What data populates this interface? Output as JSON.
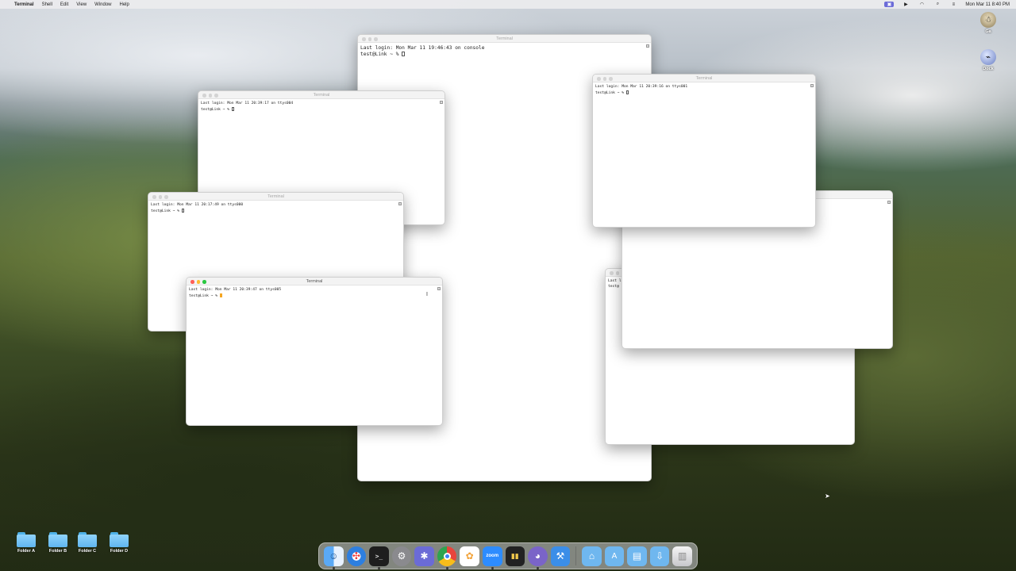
{
  "menubar": {
    "apple": "",
    "app_name": "Terminal",
    "items": [
      "Shell",
      "Edit",
      "View",
      "Window",
      "Help"
    ],
    "clock": "Mon Mar 11 8:40 PM"
  },
  "windows": {
    "console": {
      "title": "Terminal",
      "line1": "Last login: Mon Mar 11 19:46:43 on console",
      "line2": "test@Link ~ % "
    },
    "ttys004": {
      "title": "Terminal",
      "line1": "Last login: Mon Mar 11 20:39:17 on ttys004",
      "line2": "test@Link ~ % "
    },
    "ttys001": {
      "title": "Terminal",
      "line1": "Last login: Mon Mar 11 20:39:16 on ttys001",
      "line2": "test@Link ~ % "
    },
    "ttys000": {
      "title": "Terminal",
      "line1": "Last login: Mon Mar 11 20:17:49 on ttys000",
      "line2": "test@Link ~ % "
    },
    "ttys005": {
      "title": "Terminal",
      "line1": "Last login: Mon Mar 11 20:39:47 on ttys005",
      "line2": "test@Link ~ % "
    },
    "partial": {
      "line1": "Last l",
      "line2": "test@"
    }
  },
  "desktop": {
    "top_right": [
      {
        "label": "Ga",
        "icon": "character-icon"
      },
      {
        "label": "Dock",
        "icon": "disk-icon"
      }
    ],
    "folders": [
      "Folder A",
      "Folder B",
      "Folder C",
      "Folder D"
    ]
  },
  "dock": {
    "apps": [
      {
        "name": "finder-icon",
        "color": "#3d8ef0",
        "glyph": "☺"
      },
      {
        "name": "safari-icon",
        "color": "#2d7fe0",
        "glyph": "✣"
      },
      {
        "name": "terminal-icon",
        "color": "#1e1e1e",
        "glyph": ">_"
      },
      {
        "name": "system-settings-icon",
        "color": "#8a8a8e",
        "glyph": "⚙"
      },
      {
        "name": "xcode-instruments-icon",
        "color": "#6b6bd6",
        "glyph": "✱"
      },
      {
        "name": "chrome-icon",
        "color": "#e8453c",
        "glyph": "◉"
      },
      {
        "name": "photos-icon",
        "color": "#f2a33a",
        "glyph": "✿"
      },
      {
        "name": "zoom-icon",
        "color": "#2d8cff",
        "glyph": "zoom"
      },
      {
        "name": "audio-icon",
        "color": "#222",
        "glyph": "▮▮"
      },
      {
        "name": "elephant-app-icon",
        "color": "#7a64c8",
        "glyph": "◕"
      },
      {
        "name": "xcode-icon",
        "color": "#3b8ee8",
        "glyph": "⚒"
      }
    ],
    "stacks": [
      {
        "name": "home-folder-icon",
        "glyph": "⌂"
      },
      {
        "name": "applications-folder-icon",
        "glyph": "A"
      },
      {
        "name": "documents-folder-icon",
        "glyph": "▤"
      },
      {
        "name": "downloads-folder-icon",
        "glyph": "⇩"
      },
      {
        "name": "trash-icon",
        "glyph": "🗑"
      }
    ]
  }
}
